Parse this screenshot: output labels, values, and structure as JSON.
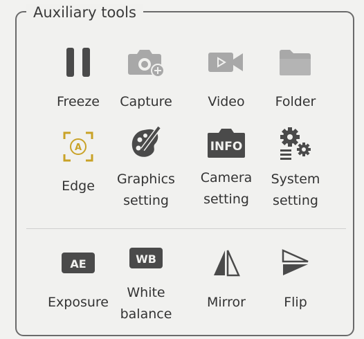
{
  "panel": {
    "title": "Auxiliary tools"
  },
  "tools": {
    "freeze": {
      "label": "Freeze",
      "icon": "pause-icon"
    },
    "capture": {
      "label": "Capture",
      "icon": "camera-plus-icon"
    },
    "video": {
      "label": "Video",
      "icon": "video-camera-icon"
    },
    "folder": {
      "label": "Folder",
      "icon": "folder-icon"
    },
    "edge": {
      "label": "Edge",
      "icon": "edge-focus-icon"
    },
    "graphics_setting": {
      "label": "Graphics\nsetting",
      "icon": "palette-icon"
    },
    "camera_setting": {
      "label": "Camera\nsetting",
      "icon": "camera-info-icon"
    },
    "system_setting": {
      "label": "System\nsetting",
      "icon": "gears-icon"
    },
    "exposure": {
      "label": "Exposure",
      "icon": "ae-icon",
      "icon_text": "AE"
    },
    "white_balance": {
      "label": "White\nbalance",
      "icon": "wb-icon",
      "icon_text": "WB"
    },
    "mirror": {
      "label": "Mirror",
      "icon": "mirror-icon"
    },
    "flip": {
      "label": "Flip",
      "icon": "flip-icon"
    }
  },
  "colors": {
    "icon_dark": "#4a4a4a",
    "icon_light": "#a8a8a8",
    "accent_edge": "#c9a227"
  }
}
